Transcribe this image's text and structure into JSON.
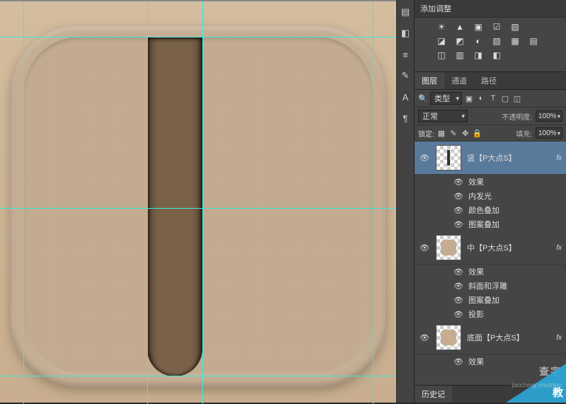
{
  "adjustments": {
    "title": "添加调整",
    "icons_row1": [
      "☀",
      "▲",
      "▣",
      "☑",
      "▨"
    ],
    "icons_row2": [
      "◪",
      "◩",
      "◐",
      "▧",
      "▦",
      "▤"
    ],
    "icons_row3": [
      "◫",
      "▥",
      "◨",
      "◧"
    ]
  },
  "tool_icons": [
    "▤",
    "◧",
    "≡",
    "✎",
    "A",
    "¶"
  ],
  "layers": {
    "tabs": {
      "layers": "图层",
      "channels": "通道",
      "paths": "路径"
    },
    "type_filter": "类型",
    "blend_mode": "正常",
    "opacity_label": "不透明度:",
    "opacity_value": "100%",
    "lock_label": "锁定:",
    "fill_label": "填充:",
    "fill_value": "100%",
    "lock_icons": [
      "▦",
      "✎",
      "✥",
      "🔒"
    ],
    "filter_icons": [
      "▣",
      "◐",
      "T",
      "▢",
      "◫"
    ],
    "items": [
      {
        "name": "竖【P大点S】",
        "selected": true,
        "thumb": "v",
        "fx_label": "效果",
        "effects": [
          "内发光",
          "颜色叠加",
          "图案叠加"
        ]
      },
      {
        "name": "中【P大点S】",
        "selected": false,
        "thumb": "sq",
        "fx_label": "效果",
        "effects": [
          "斜面和浮雕",
          "图案叠加",
          "投影"
        ]
      },
      {
        "name": "底面【P大点S】",
        "selected": false,
        "thumb": "sq",
        "fx_label": "效果",
        "effects": []
      }
    ],
    "fx_badge": "fx"
  },
  "bottom_panel": {
    "history": "历史记"
  },
  "watermark": {
    "line1": "查字",
    "line2": "教",
    "site": "jiaocheng.chazidian"
  }
}
